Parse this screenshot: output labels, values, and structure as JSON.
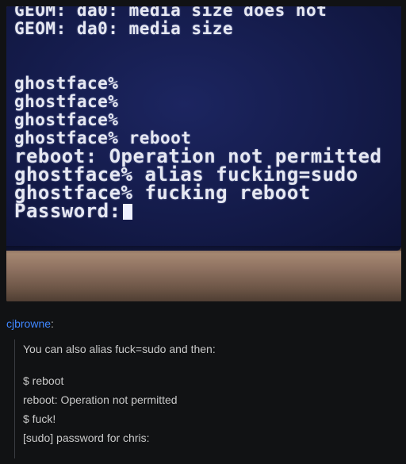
{
  "photo": {
    "terminal_lines": [
      "GEOM: da0: media size does not",
      "GEOM: da0: media size",
      "ghostface%",
      "ghostface%",
      "ghostface%",
      "ghostface% reboot",
      "reboot: Operation not permitted",
      "ghostface% alias fucking=sudo",
      "ghostface% fucking reboot",
      "Password:"
    ]
  },
  "post": {
    "username": "cjbrowne",
    "colon": ":",
    "quote_lines": [
      "You can also alias fuck=sudo and then:",
      "$ reboot",
      "reboot: Operation not permitted",
      "$ fuck!",
      "[sudo] password for chris:"
    ]
  },
  "colors": {
    "background": "#111214",
    "username_link": "#3f86ff",
    "screen": "#141b4a"
  }
}
